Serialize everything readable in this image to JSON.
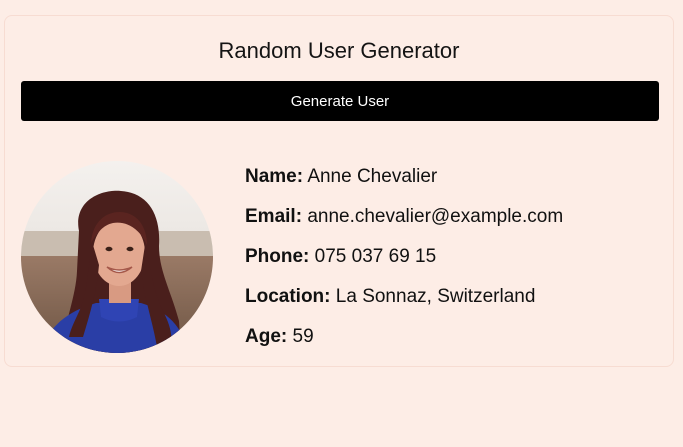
{
  "app": {
    "title": "Random User Generator",
    "generate_label": "Generate User"
  },
  "user": {
    "fields": [
      {
        "label": "Name:",
        "value": "Anne Chevalier"
      },
      {
        "label": "Email:",
        "value": "anne.chevalier@example.com"
      },
      {
        "label": "Phone:",
        "value": "075 037 69 15"
      },
      {
        "label": "Location:",
        "value": "La Sonnaz, Switzerland"
      },
      {
        "label": "Age:",
        "value": "59"
      }
    ]
  },
  "colors": {
    "page_background": "#fdede6",
    "button_background": "#000000",
    "button_text": "#ffffff"
  }
}
